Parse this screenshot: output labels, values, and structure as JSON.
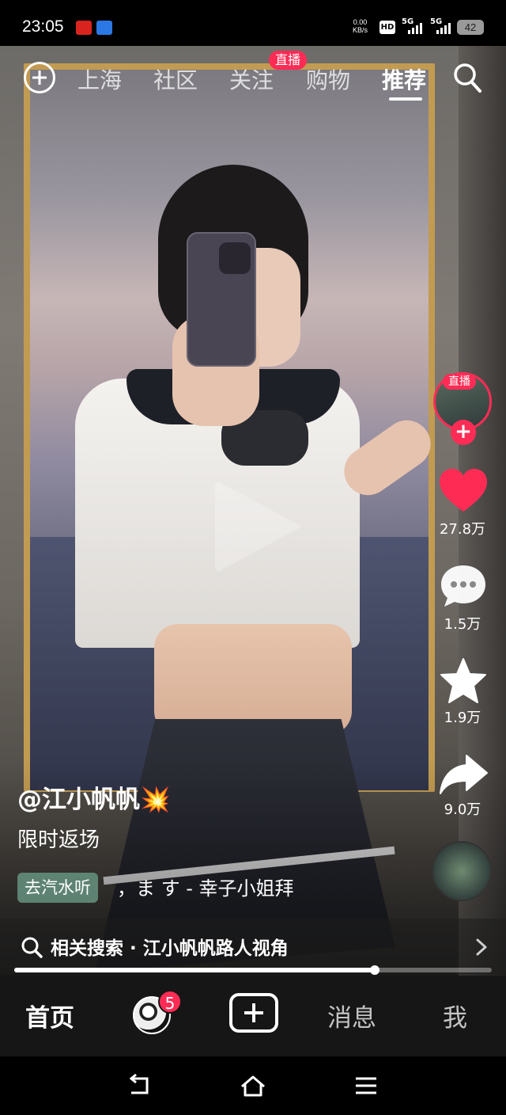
{
  "status_bar": {
    "time": "23:05",
    "net_speed_value": "0.00",
    "net_speed_unit": "KB/s",
    "hd_label": "HD",
    "sim1_label": "5G",
    "sim2_label": "5G",
    "battery": "42"
  },
  "top_nav": {
    "tabs": [
      {
        "label": "上海"
      },
      {
        "label": "社区"
      },
      {
        "label": "关注"
      },
      {
        "label": "购物"
      },
      {
        "label": "推荐"
      }
    ],
    "active_tab": "推荐",
    "live_badge": "直播",
    "icons": [
      "add-circle-icon",
      "search-icon"
    ]
  },
  "side_rail": {
    "live_label": "直播",
    "follow_symbol": "+",
    "likes": "27.8万",
    "comments": "1.5万",
    "favorites": "1.9万",
    "shares": "9.0万",
    "colors": {
      "accent": "#fe2c55",
      "like": "#fe2c55"
    }
  },
  "caption": {
    "author": "@江小帆帆",
    "author_emoji": "💥",
    "description": "限时返场",
    "music_tag": "去汽水听",
    "music_title": "，ま す - 幸子小姐拜"
  },
  "related_search": {
    "prefix": "相关搜索",
    "separator": "·",
    "query": "江小帆帆路人视角"
  },
  "playback": {
    "progress": 0.755
  },
  "bottom_tabs": {
    "home": "首页",
    "friends_badge": "5",
    "messages": "消息",
    "me": "我"
  }
}
